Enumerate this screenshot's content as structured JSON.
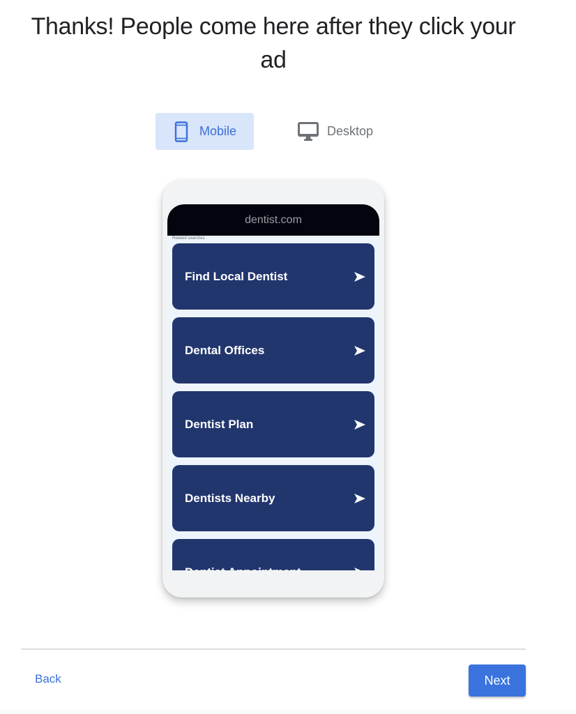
{
  "header": {
    "title": "Thanks! People come here after they click your ad"
  },
  "device_toggle": {
    "options": [
      {
        "label": "Mobile",
        "icon": "smartphone-icon",
        "selected": true
      },
      {
        "label": "Desktop",
        "icon": "desktop-monitor-icon",
        "selected": false
      }
    ]
  },
  "preview": {
    "url": "dentist.com",
    "section_label": "Related searches",
    "results": [
      {
        "label": "Find Local Dentist",
        "icon": "arrow-right-icon"
      },
      {
        "label": "Dental Offices",
        "icon": "arrow-right-icon"
      },
      {
        "label": "Dentist Plan",
        "icon": "arrow-right-icon"
      },
      {
        "label": "Dentists Nearby",
        "icon": "arrow-right-icon"
      },
      {
        "label": "Dentist Appointment",
        "icon": "arrow-right-icon"
      }
    ]
  },
  "footer": {
    "back_label": "Back",
    "next_label": "Next"
  },
  "colors": {
    "accent": "#3a73de",
    "selected_toggle_bg": "#d8e5fb",
    "result_card_bg": "#22366e",
    "url_bar_bg": "#04040f"
  }
}
